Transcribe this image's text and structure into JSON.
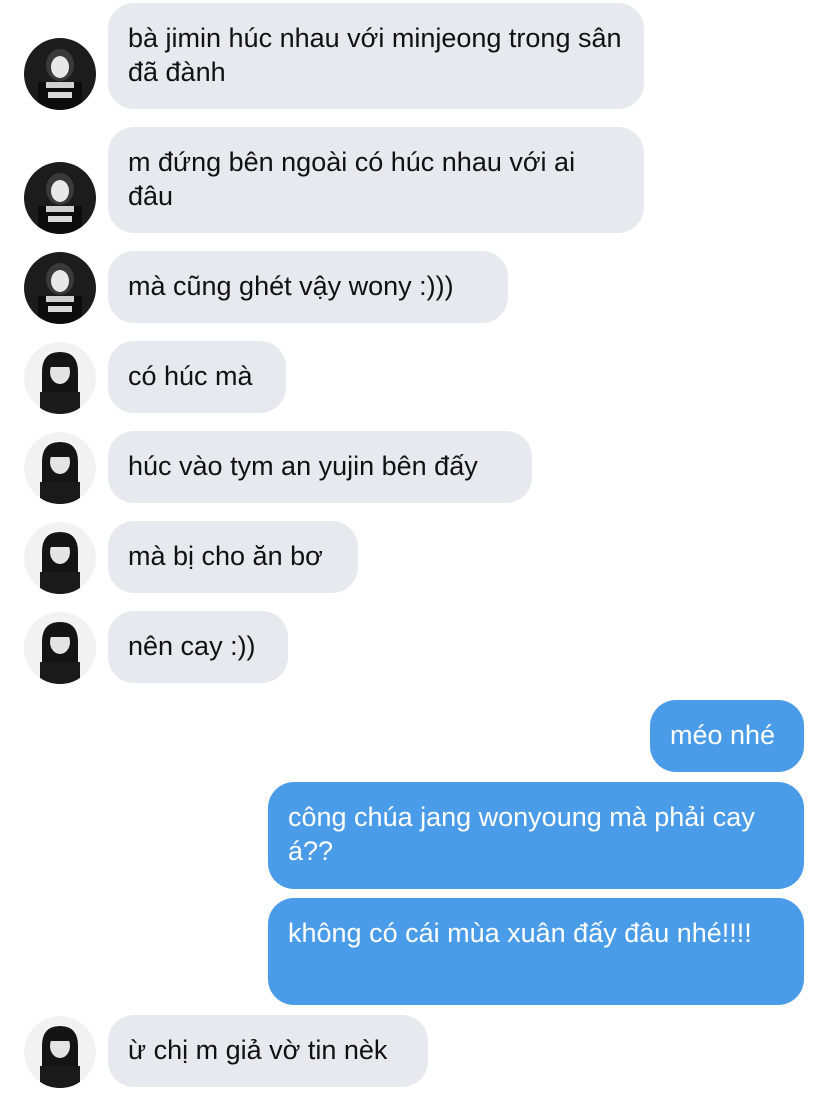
{
  "conversation": {
    "messages": [
      {
        "sender": "jimin",
        "text": "bà jimin húc nhau với minjeong trong sân đã đành"
      },
      {
        "sender": "jimin",
        "text": "m đứng bên ngoài có húc nhau với ai đâu"
      },
      {
        "sender": "jimin",
        "text": "mà cũng ghét vậy wony :)))"
      },
      {
        "sender": "yujin",
        "text": "có húc mà"
      },
      {
        "sender": "yujin",
        "text": "húc vào tym an yujin bên đấy"
      },
      {
        "sender": "yujin",
        "text": "mà bị cho ăn bơ"
      },
      {
        "sender": "yujin",
        "text": "nên cay :))"
      },
      {
        "sender": "me",
        "text": "méo nhé"
      },
      {
        "sender": "me",
        "text": "công chúa jang wonyoung mà phải cay á??"
      },
      {
        "sender": "me",
        "text": "không có cái mùa xuân đấy đâu nhé!!!!"
      },
      {
        "sender": "yujin",
        "text": "ừ chị m giả vờ tin nèk"
      }
    ]
  },
  "colors": {
    "incoming_bubble": "#e7e9ee",
    "outgoing_bubble": "#4a9ce8",
    "incoming_text": "#111111",
    "outgoing_text": "#ffffff"
  },
  "icons": {
    "avatar_a": "profile-photo-avatar",
    "avatar_b": "profile-photo-avatar"
  }
}
